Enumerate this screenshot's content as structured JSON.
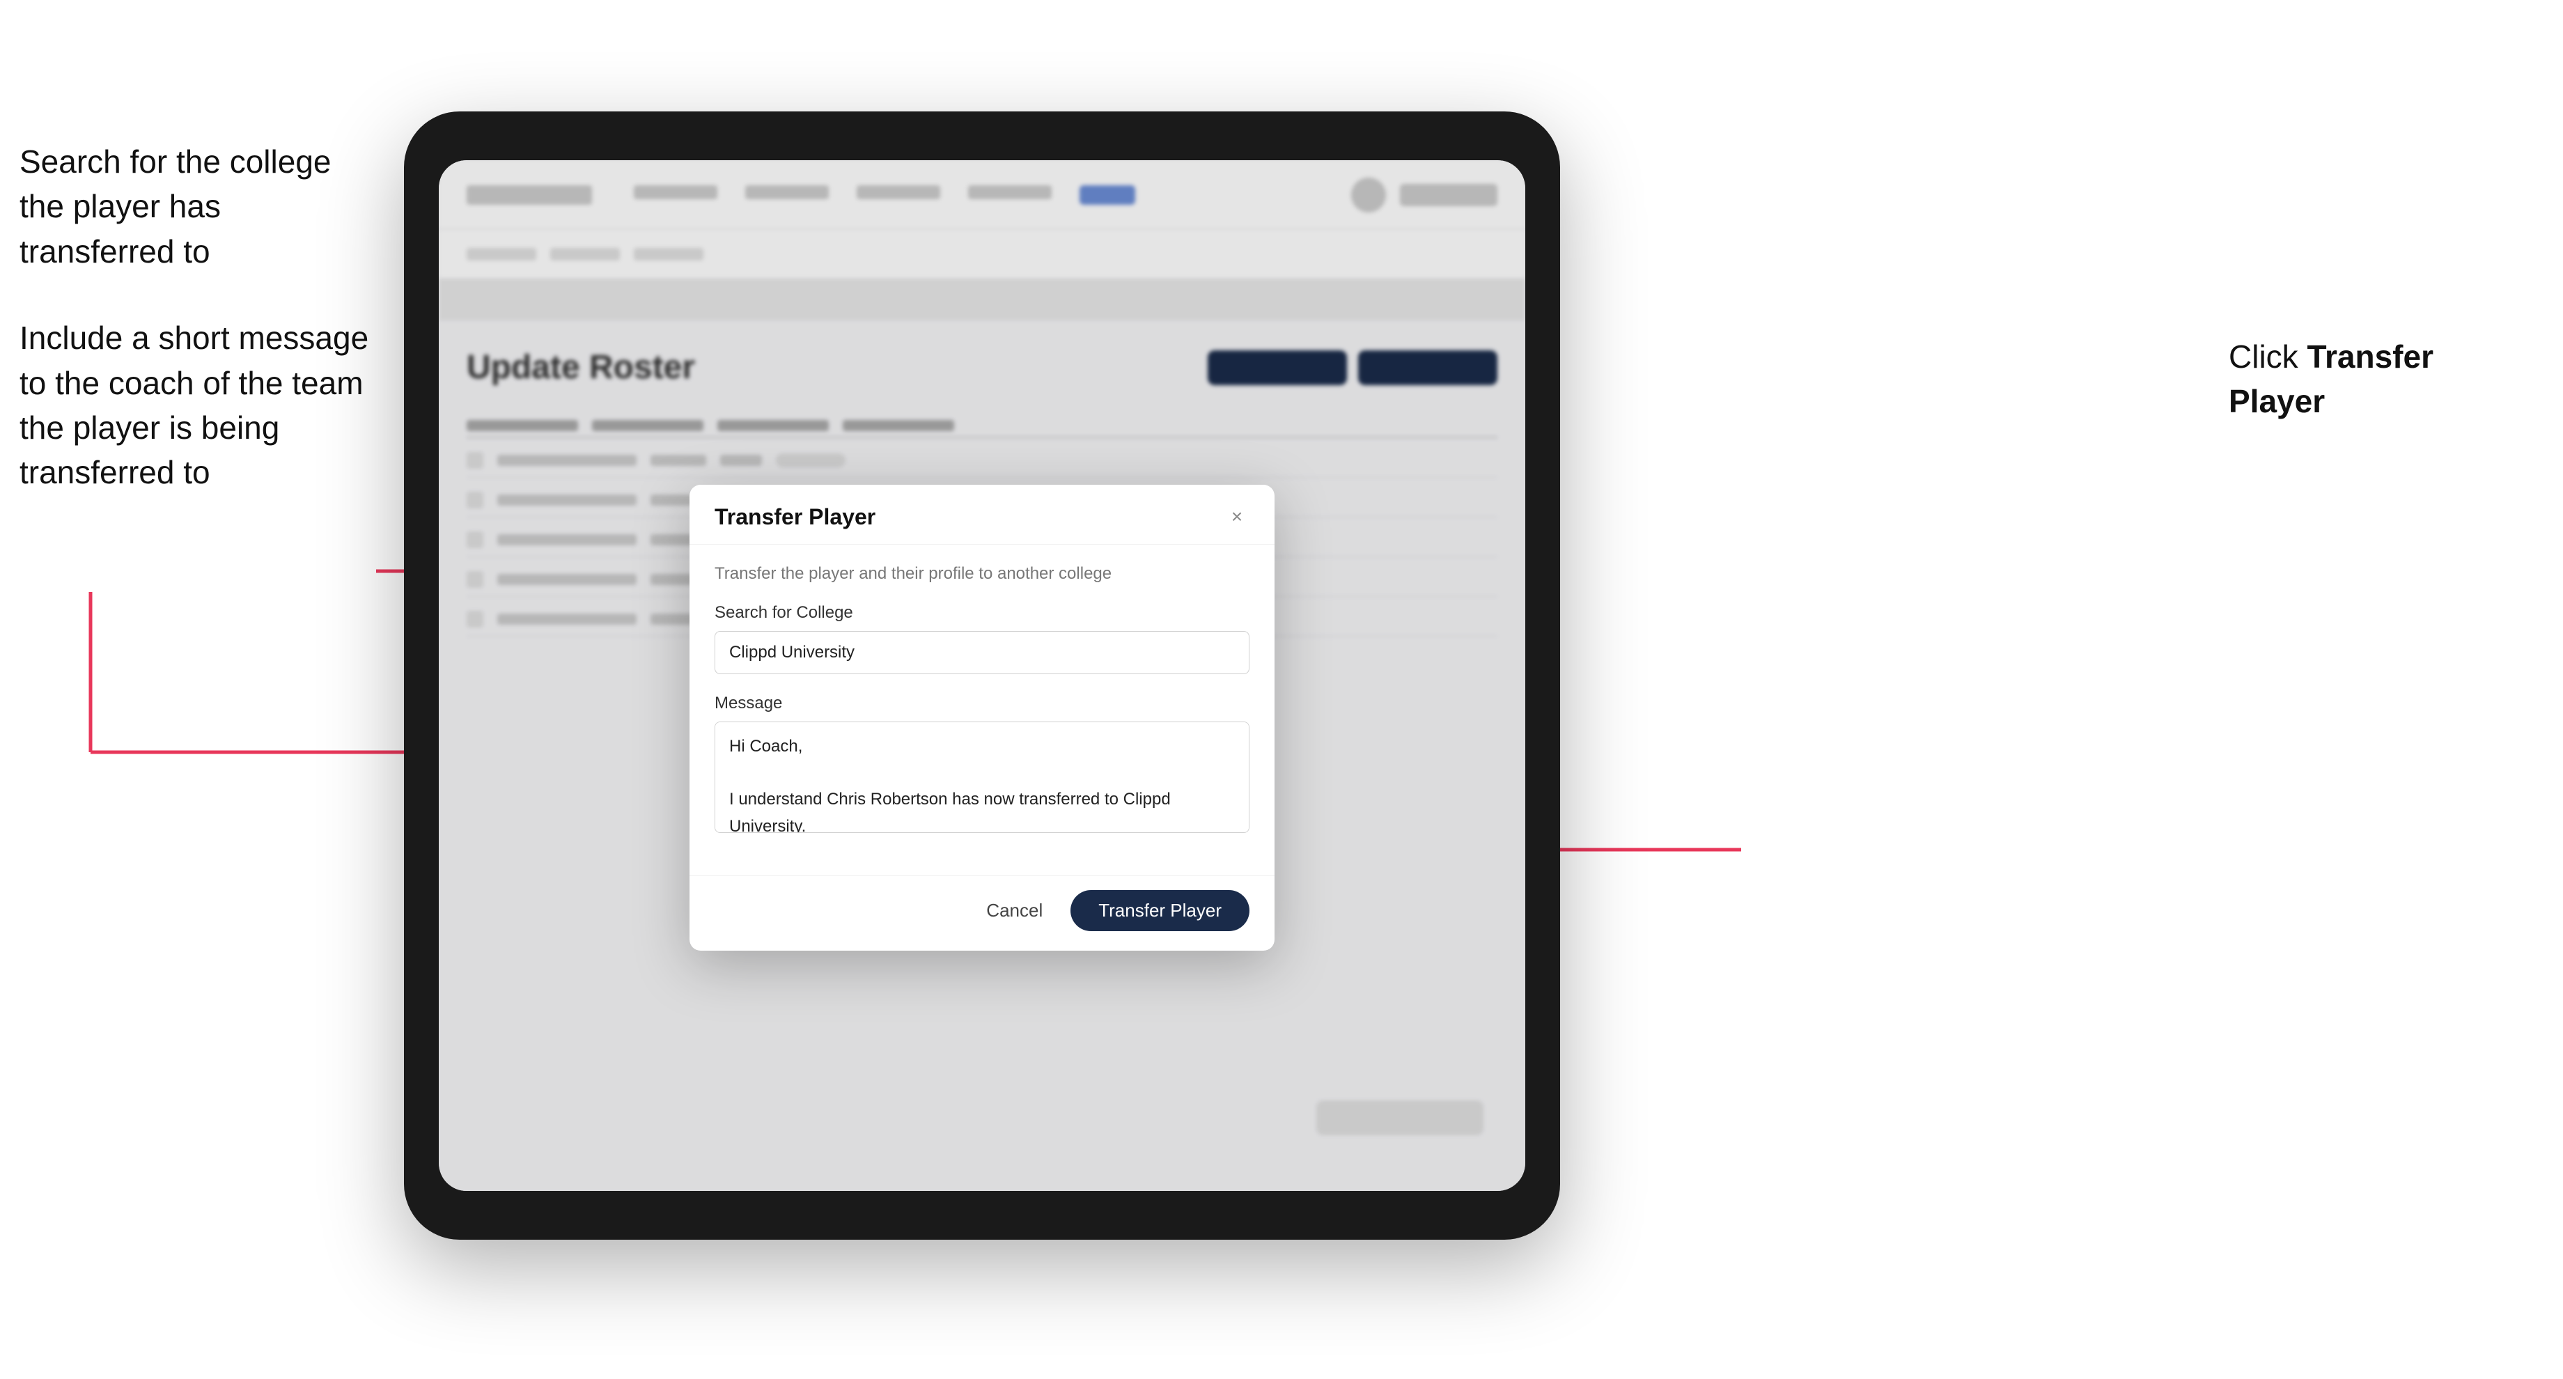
{
  "annotations": {
    "left_top": "Search for the college the player has transferred to",
    "left_bottom": "Include a short message\nto the coach of the team\nthe player is being\ntransferred to",
    "right": "Click Transfer Player"
  },
  "modal": {
    "title": "Transfer Player",
    "subtitle": "Transfer the player and their profile to another college",
    "search_label": "Search for College",
    "search_value": "Clippd University",
    "message_label": "Message",
    "message_value": "Hi Coach,\n\nI understand Chris Robertson has now transferred to Clippd University.\nPlease accept this transfer request when you can.",
    "cancel_label": "Cancel",
    "transfer_label": "Transfer Player",
    "close_icon": "×"
  },
  "app": {
    "content_title": "Update Roster"
  }
}
